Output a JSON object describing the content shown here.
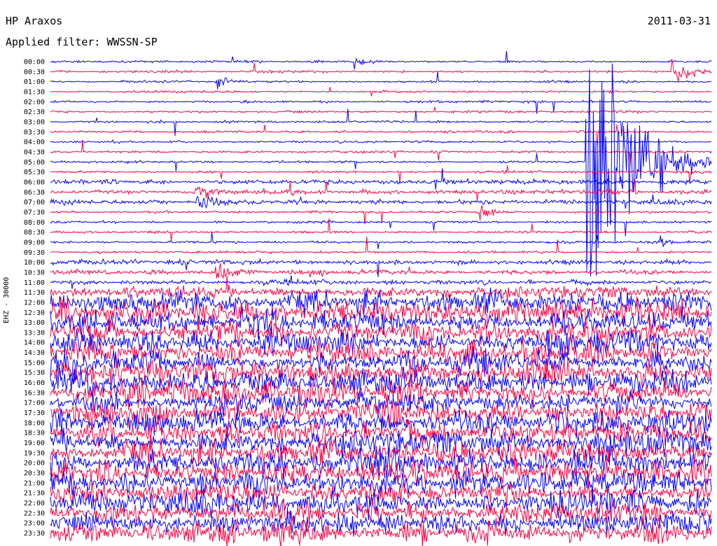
{
  "header": {
    "station": "HP Araxos",
    "date": "2011-03-31",
    "filter_label": "Applied filter: WWSSN-SP",
    "channel": "EHZ - 30000"
  },
  "colors": {
    "trace_a": "#0000ff",
    "trace_b": "#ff0040",
    "background": "#ffffff",
    "text": "#000000"
  },
  "chart_data": {
    "type": "line",
    "title": "HP Araxos",
    "subtitle": "Applied filter: WWSSN-SP",
    "ylabel": "EHZ - 30000",
    "row_labels": [
      "00:00",
      "00:30",
      "01:00",
      "01:30",
      "02:00",
      "02:30",
      "03:00",
      "03:30",
      "04:00",
      "04:30",
      "05:00",
      "05:30",
      "06:00",
      "06:30",
      "07:00",
      "07:30",
      "08:00",
      "08:30",
      "09:00",
      "09:30",
      "10:00",
      "10:30",
      "11:00",
      "11:30",
      "12:00",
      "12:30",
      "13:00",
      "13:30",
      "14:00",
      "14:30",
      "15:00",
      "15:30",
      "16:00",
      "16:30",
      "17:00",
      "17:30",
      "18:00",
      "18:30",
      "19:00",
      "19:30",
      "20:00",
      "20:30",
      "21:00",
      "21:30",
      "22:00",
      "22:30",
      "23:00",
      "23:30"
    ],
    "row_minutes": 30,
    "row_colors_alternate": [
      "#0000ff",
      "#ff0040"
    ],
    "noise_level": [
      1,
      1,
      1,
      1,
      1,
      1,
      1,
      1,
      1,
      1,
      1,
      1,
      2,
      2,
      2,
      1,
      1,
      1,
      1,
      1,
      2,
      2,
      2,
      5,
      9,
      10,
      10,
      10,
      10,
      10,
      10,
      10,
      10,
      10,
      10,
      10,
      10,
      10,
      10,
      10,
      10,
      10,
      10,
      10,
      10,
      10,
      10,
      10
    ],
    "events": [
      {
        "row": 1,
        "position": 0.94,
        "amplitude": 12,
        "duration": 0.03
      },
      {
        "row": 0,
        "position": 0.46,
        "amplitude": 6,
        "duration": 0.02
      },
      {
        "row": 2,
        "position": 0.25,
        "amplitude": 6,
        "duration": 0.02
      },
      {
        "row": 13,
        "position": 0.22,
        "amplitude": 8,
        "duration": 0.03
      },
      {
        "row": 14,
        "position": 0.22,
        "amplitude": 8,
        "duration": 0.03
      },
      {
        "row": 15,
        "position": 0.65,
        "amplitude": 10,
        "duration": 0.02
      },
      {
        "row": 21,
        "position": 0.25,
        "amplitude": 10,
        "duration": 0.03
      },
      {
        "row": 18,
        "position": 0.92,
        "amplitude": 7,
        "duration": 0.02
      },
      {
        "row": 10,
        "position": 0.81,
        "amplitude": 150,
        "duration": 0.06
      }
    ]
  }
}
